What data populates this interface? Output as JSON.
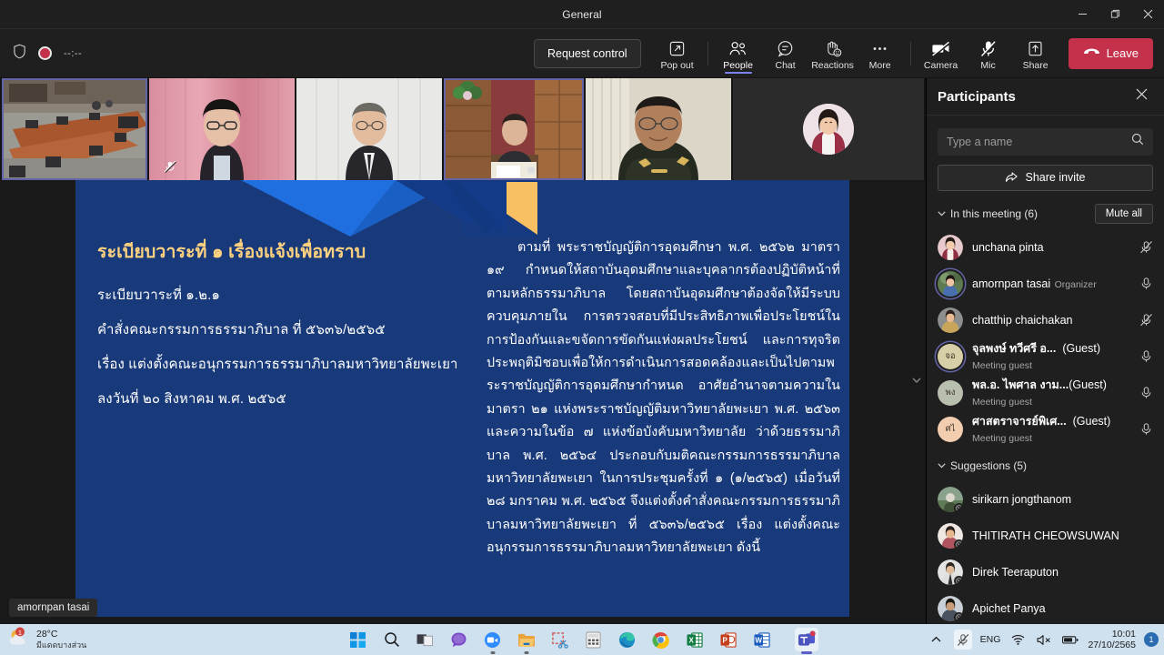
{
  "window": {
    "title": "General",
    "minimize_label": "Minimize",
    "restore_label": "Restore",
    "close_label": "Close"
  },
  "toolbar": {
    "timer": "--:--",
    "request_control_label": "Request control",
    "items": [
      {
        "label": "Pop out",
        "icon": "pop-out-icon",
        "active": false
      },
      {
        "label": "People",
        "icon": "people-icon",
        "active": true
      },
      {
        "label": "Chat",
        "icon": "chat-icon",
        "active": false
      },
      {
        "label": "Reactions",
        "icon": "reactions-icon",
        "active": false
      },
      {
        "label": "More",
        "icon": "more-icon",
        "active": false
      }
    ],
    "controls": [
      {
        "label": "Camera",
        "icon": "camera-off-icon"
      },
      {
        "label": "Mic",
        "icon": "mic-off-icon"
      },
      {
        "label": "Share",
        "icon": "share-icon"
      }
    ],
    "leave_label": "Leave",
    "leave_color": "#c4314b"
  },
  "stage": {
    "presenter_name_badge": "amornpan tasai",
    "tiles": [
      {
        "name": "meeting-room-camera",
        "speaking": true,
        "muted": false,
        "camera_on": true
      },
      {
        "name": "participant-2",
        "speaking": false,
        "muted": true,
        "camera_on": true
      },
      {
        "name": "participant-3",
        "speaking": false,
        "muted": false,
        "camera_on": true
      },
      {
        "name": "participant-4",
        "speaking": true,
        "muted": false,
        "camera_on": true
      },
      {
        "name": "participant-5",
        "speaking": false,
        "muted": false,
        "camera_on": true
      },
      {
        "name": "participant-6",
        "speaking": false,
        "muted": false,
        "camera_on": false
      }
    ]
  },
  "slide": {
    "background_color": "#193a7a",
    "heading_color": "#ffd27f",
    "deco_colors": {
      "bright_blue": "#1f6fe0",
      "dark_blue": "#123a86",
      "amber": "#f9bf63"
    },
    "heading": "ระเบียบวาระที่ ๑ เรื่องแจ้งเพื่อทราบ",
    "left_lines": [
      "ระเบียบวาระที่ ๑.๒.๑",
      "คำสั่งคณะกรรมการธรรมาภิบาล ที่ ๕๖๓๖/๒๕๖๕",
      "เรื่อง แต่งตั้งคณะอนุกรรมการธรรมาภิบาลมหาวิทยาลัยพะเยา",
      "ลงวันที่ ๒๐ สิงหาคม พ.ศ. ๒๕๖๕"
    ],
    "right_paragraph": "ตามที่ พระราชบัญญัติการอุดมศึกษา พ.ศ. ๒๕๖๒ มาตรา ๑๙ กำหนดให้สถาบันอุดมศึกษาและบุคลากรต้องปฏิบัติหน้าที่ตามหลักธรรมาภิบาล โดยสถาบันอุดมศึกษาต้องจัดให้มีระบบควบคุมภายใน การตรวจสอบที่มีประสิทธิภาพเพื่อประโยชน์ในการป้องกันและขจัดการขัดกันแห่งผลประโยชน์ และการทุจริตประพฤติมิชอบเพื่อให้การดำเนินการสอดคล้องและเป็นไปตามพระราชบัญญัติการอุดมศึกษากำหนด อาศัยอำนาจตามความในมาตรา ๒๑ แห่งพระราชบัญญัติมหาวิทยาลัยพะเยา พ.ศ. ๒๕๖๓ และความในข้อ ๗ แห่งข้อบังคับมหาวิทยาลัย ว่าด้วยธรรมาภิบาล พ.ศ. ๒๕๖๔ ประกอบกับมติคณะกรรมการธรรมาภิบาลมหาวิทยาลัยพะเยา ในการประชุมครั้งที่ ๑ (๑/๒๕๖๕) เมื่อวันที่ ๒๘ มกราคม พ.ศ. ๒๕๖๕ จึงแต่งตั้งคำสั่งคณะกรรมการธรรมาภิบาลมหาวิทยาลัยพะเยา ที่ ๕๖๓๖/๒๕๖๕ เรื่อง แต่งตั้งคณะอนุกรรมการธรรมาภิบาลมหาวิทยาลัยพะเยา ดังนี้"
  },
  "panel": {
    "title": "Participants",
    "close_label": "Close",
    "search_placeholder": "Type a name",
    "search_value": "",
    "share_invite_label": "Share invite",
    "in_meeting_label": "In this meeting (6)",
    "mute_all_label": "Mute all",
    "suggestions_label": "Suggestions (5)",
    "in_meeting": [
      {
        "name": "unchana pinta",
        "sub": "",
        "guest": "",
        "mic": "muted",
        "avatar_type": "photo",
        "avatar_color": "#e7c9ce",
        "initials": "",
        "ring": false
      },
      {
        "name": "amornpan tasai",
        "sub": "Organizer",
        "guest": "",
        "mic": "unmuted",
        "avatar_type": "photo",
        "avatar_color": "#5d7a51",
        "initials": "",
        "ring": true
      },
      {
        "name": "chatthip chaichakan",
        "sub": "",
        "guest": "",
        "mic": "muted",
        "avatar_type": "photo",
        "avatar_color": "#c9a45b",
        "initials": "",
        "ring": false
      },
      {
        "name": "จุลพงษ์ ทวีศรี อ...",
        "sub": "Meeting guest",
        "guest": "(Guest)",
        "mic": "unmuted",
        "avatar_type": "initials",
        "avatar_color": "#d7cfa8",
        "initials": "จอ",
        "ring": true
      },
      {
        "name": "พล.อ. ไพศาล งาม...",
        "sub": "Meeting guest",
        "guest": "(Guest)",
        "mic": "unmuted",
        "avatar_type": "initials",
        "avatar_color": "#b9bfae",
        "initials": "พง",
        "ring": false
      },
      {
        "name": "ศาสตราจารย์พิเศ...",
        "sub": "Meeting guest",
        "guest": "(Guest)",
        "mic": "unmuted",
        "avatar_type": "initials",
        "avatar_color": "#f2cdb0",
        "initials": "ศไ",
        "ring": false
      }
    ],
    "suggestions": [
      {
        "name": "sirikarn jongthanom",
        "avatar_color": "#8aa28b",
        "status": "offline"
      },
      {
        "name": "THITIRATH CHEOWSUWAN",
        "avatar_color": "#b06a70",
        "status": "offline"
      },
      {
        "name": "Direk Teeraputon",
        "avatar_color": "#d6d6d6",
        "status": "offline"
      },
      {
        "name": "Apichet Panya",
        "avatar_color": "#6f7f91",
        "status": "offline"
      }
    ]
  },
  "taskbar": {
    "weather_temp": "28°C",
    "weather_desc": "มีแดดบางส่วน",
    "apps": [
      {
        "name": "start-button",
        "running": false
      },
      {
        "name": "search-button",
        "running": false
      },
      {
        "name": "task-view-button",
        "running": false
      },
      {
        "name": "chat-button",
        "running": false
      },
      {
        "name": "zoom-app",
        "running": true
      },
      {
        "name": "file-explorer-app",
        "running": true
      },
      {
        "name": "snipping-tool-app",
        "running": false
      },
      {
        "name": "calculator-app",
        "running": false
      },
      {
        "name": "edge-browser-app",
        "running": false
      },
      {
        "name": "chrome-browser-app",
        "running": false
      },
      {
        "name": "excel-app",
        "running": false
      },
      {
        "name": "powerpoint-app",
        "running": false
      },
      {
        "name": "word-app",
        "running": false
      },
      {
        "name": "teams-app",
        "running": true
      }
    ],
    "language": "ENG",
    "time": "10:01",
    "date": "27/10/2565",
    "notification_count": "1"
  }
}
